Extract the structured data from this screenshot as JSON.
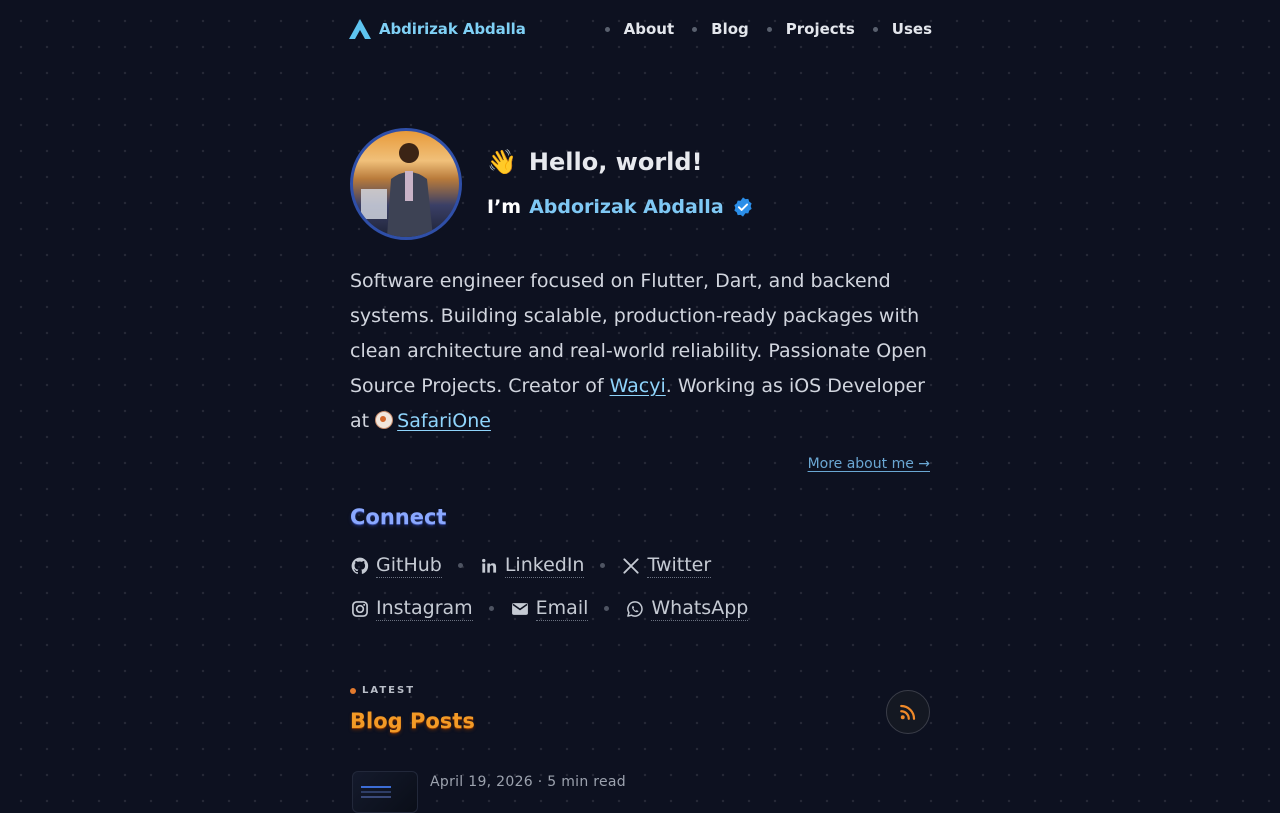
{
  "header": {
    "site_name": "Abdirizak Abdalla",
    "nav": [
      "About",
      "Blog",
      "Projects",
      "Uses"
    ]
  },
  "hero": {
    "wave_emoji": "👋",
    "greeting": "Hello, world!",
    "iam_prefix": "I’m",
    "name": "Abdorizak Abdalla",
    "verified_icon": "verified-badge-icon"
  },
  "bio": {
    "text_1": "Software engineer focused on Flutter, Dart, and backend systems. Building scalable, production-ready packages with clean architecture and real-world reliability. Passionate Open Source Projects. Creator of ",
    "link_wacyi": "Wacyi",
    "text_2": ". Working as iOS Developer at ",
    "link_company": "SafariOne"
  },
  "more_link": "More about me →",
  "connect": {
    "title": "Connect",
    "links": [
      {
        "label": "GitHub",
        "icon": "github-icon"
      },
      {
        "label": "LinkedIn",
        "icon": "linkedin-icon"
      },
      {
        "label": "Twitter",
        "icon": "x-twitter-icon"
      },
      {
        "label": "Instagram",
        "icon": "instagram-icon"
      },
      {
        "label": "Email",
        "icon": "mail-icon"
      },
      {
        "label": "WhatsApp",
        "icon": "whatsapp-icon"
      }
    ]
  },
  "blog": {
    "eyebrow": "LATEST",
    "title": "Blog Posts",
    "rss_icon": "rss-icon",
    "posts": [
      {
        "meta": "April 19, 2026 · 5 min read"
      }
    ]
  },
  "colors": {
    "background": "#0d1120",
    "accent_blue": "#7fc8f4",
    "connect_title": "#8aa8ff",
    "blog_title": "#f39a26"
  }
}
